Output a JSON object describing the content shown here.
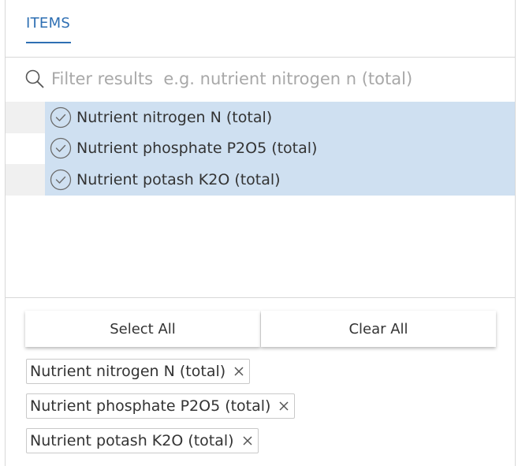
{
  "tabs": [
    {
      "label": "ITEMS",
      "active": true
    }
  ],
  "search": {
    "placeholder": "Filter results  e.g. nutrient nitrogen n (total)",
    "value": ""
  },
  "results": [
    {
      "label": "Nutrient nitrogen N (total)",
      "selected": true
    },
    {
      "label": "Nutrient phosphate P2O5 (total)",
      "selected": true
    },
    {
      "label": "Nutrient potash K2O (total)",
      "selected": true
    }
  ],
  "actions": {
    "select_all": "Select All",
    "clear_all": "Clear All"
  },
  "selected_chips": [
    {
      "label": "Nutrient nitrogen N (total)"
    },
    {
      "label": "Nutrient phosphate P2O5 (total)"
    },
    {
      "label": "Nutrient potash K2O (total)"
    }
  ],
  "icons": {
    "search": "search-icon",
    "check": "check-circle-icon",
    "remove": "close-icon"
  },
  "colors": {
    "accent": "#2e6fb3",
    "selected_row": "#cfe0f1",
    "border": "#d8d8d8"
  }
}
